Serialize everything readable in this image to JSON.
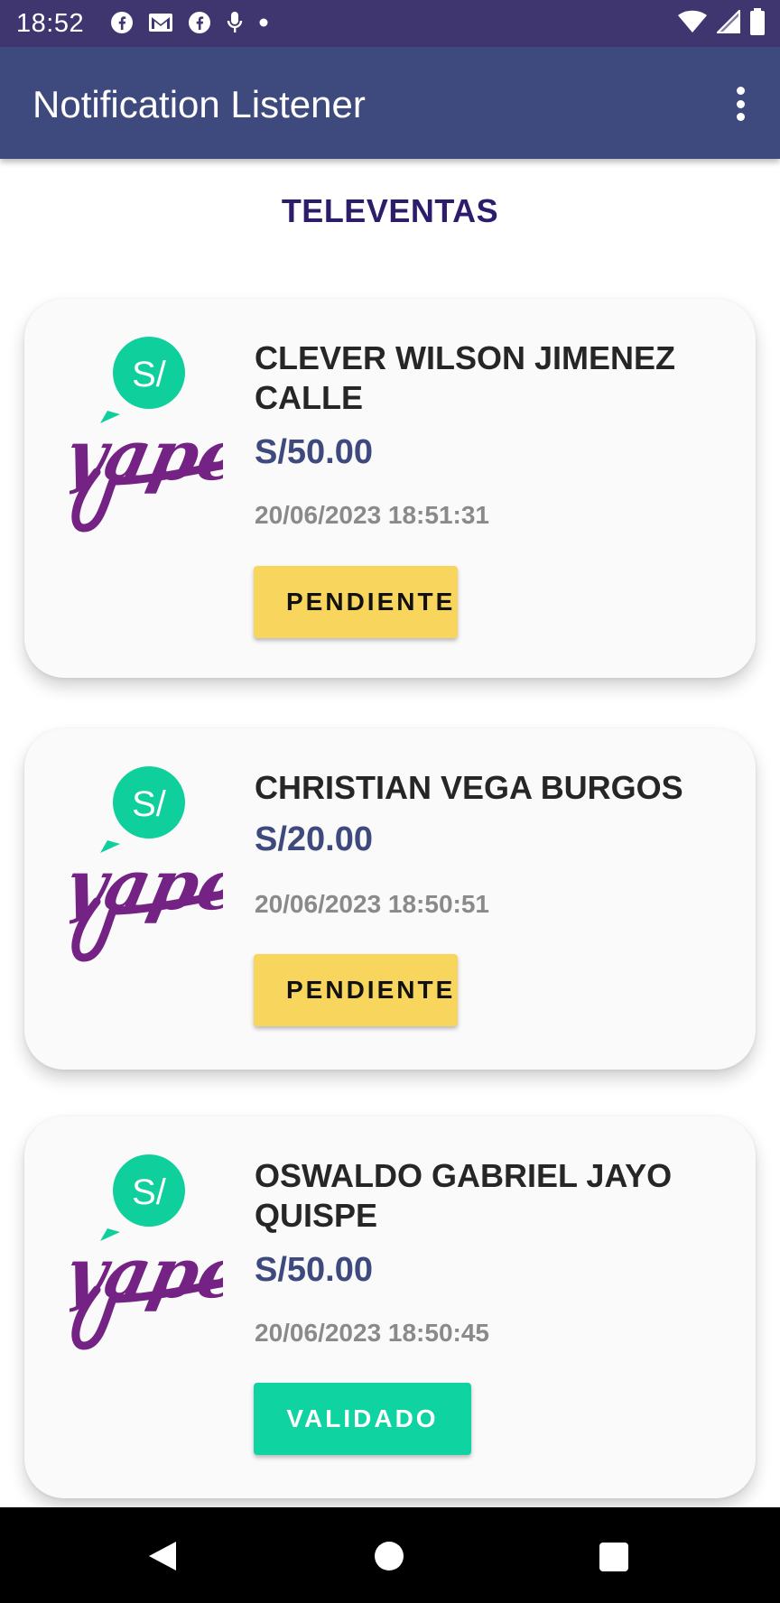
{
  "status_bar": {
    "time": "18:52",
    "left_icons": [
      "facebook-icon",
      "gmail-icon",
      "facebook-icon",
      "microphone-icon",
      "dot-icon"
    ],
    "right_icons": [
      "wifi-icon",
      "signal-icon",
      "battery-icon"
    ]
  },
  "app_bar": {
    "title": "Notification Listener",
    "menu_icon": "overflow-menu-icon"
  },
  "section": {
    "title": "TELEVENTAS"
  },
  "payments": [
    {
      "logo_text": "yape",
      "logo_badge": "S/",
      "name": "CLEVER WILSON JIMENEZ CALLE",
      "amount": "S/50.00",
      "datetime": "20/06/2023 18:51:31",
      "status": "PENDIENTE",
      "status_color": "#f8d55c"
    },
    {
      "logo_text": "yape",
      "logo_badge": "S/",
      "name": "CHRISTIAN VEGA BURGOS",
      "amount": "S/20.00",
      "datetime": "20/06/2023 18:50:51",
      "status": "PENDIENTE",
      "status_color": "#f8d55c"
    },
    {
      "logo_text": "yape",
      "logo_badge": "S/",
      "name": "OSWALDO GABRIEL JAYO QUISPE",
      "amount": "S/50.00",
      "datetime": "20/06/2023 18:50:45",
      "status": "VALIDADO",
      "status_color": "#0fd3a1"
    }
  ],
  "colors": {
    "app_bar": "#3e4a7e",
    "status_bar": "#40366f",
    "section_title": "#2d1b6b",
    "amount": "#3e4a7e",
    "yape_purple": "#742284",
    "yape_teal": "#0fcf9c"
  },
  "nav_bar": {
    "icons": [
      "back-icon",
      "home-icon",
      "recents-icon"
    ]
  }
}
